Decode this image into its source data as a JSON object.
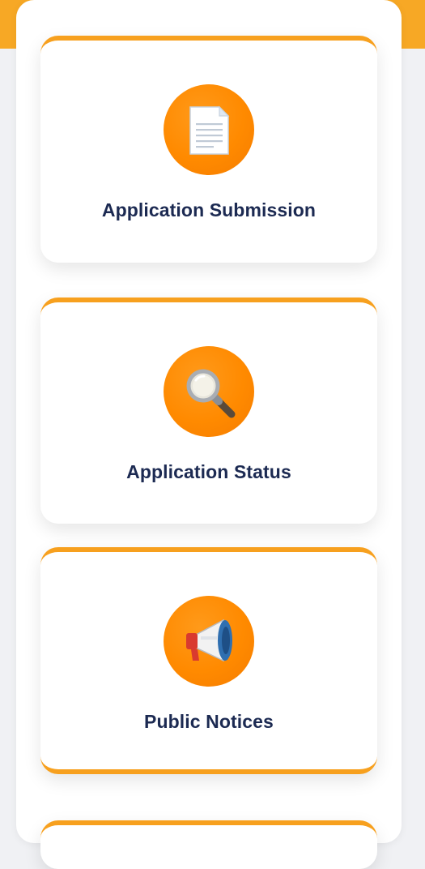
{
  "cards": [
    {
      "label": "Application Submission",
      "icon": "document-icon"
    },
    {
      "label": "Application Status",
      "icon": "magnifier-icon"
    },
    {
      "label": "Public Notices",
      "icon": "megaphone-icon"
    }
  ],
  "colors": {
    "accent": "#f7a01e",
    "icon_circle": "#ff8a00",
    "label_text": "#1c2a52",
    "background": "#f0f1f4"
  }
}
